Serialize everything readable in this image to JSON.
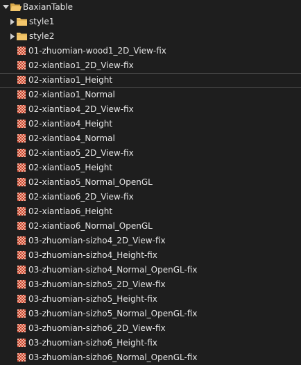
{
  "tree": {
    "root": {
      "label": "BaxianTable",
      "expanded": true,
      "icon": "folder-open-icon"
    },
    "folders": [
      {
        "label": "style1",
        "expanded": false,
        "icon": "folder-icon"
      },
      {
        "label": "style2",
        "expanded": false,
        "icon": "folder-icon"
      }
    ],
    "textures": [
      "01-zhuomian-wood1_2D_View-fix",
      "02-xiantiao1_2D_View-fix",
      "02-xiantiao1_Height",
      "02-xiantiao1_Normal",
      "02-xiantiao4_2D_View-fix",
      "02-xiantiao4_Height",
      "02-xiantiao4_Normal",
      "02-xiantiao5_2D_View-fix",
      "02-xiantiao5_Height",
      "02-xiantiao5_Normal_OpenGL",
      "02-xiantiao6_2D_View-fix",
      "02-xiantiao6_Height",
      "02-xiantiao6_Normal_OpenGL",
      "03-zhuomian-sizho4_2D_View-fix",
      "03-zhuomian-sizho4_Height-fix",
      "03-zhuomian-sizho4_Normal_OpenGL-fix",
      "03-zhuomian-sizho5_2D_View-fix",
      "03-zhuomian-sizho5_Height-fix",
      "03-zhuomian-sizho5_Normal_OpenGL-fix",
      "03-zhuomian-sizho6_2D_View-fix",
      "03-zhuomian-sizho6_Height-fix",
      "03-zhuomian-sizho6_Normal_OpenGL-fix"
    ],
    "texture_icon": "texture-checker-icon",
    "selected_index": 2
  },
  "colors": {
    "background": "#1e1e1e",
    "text": "#e6e6e6",
    "folder": "#f3c66b",
    "texture_a": "#c8432d",
    "texture_b": "#f1b7a3"
  }
}
